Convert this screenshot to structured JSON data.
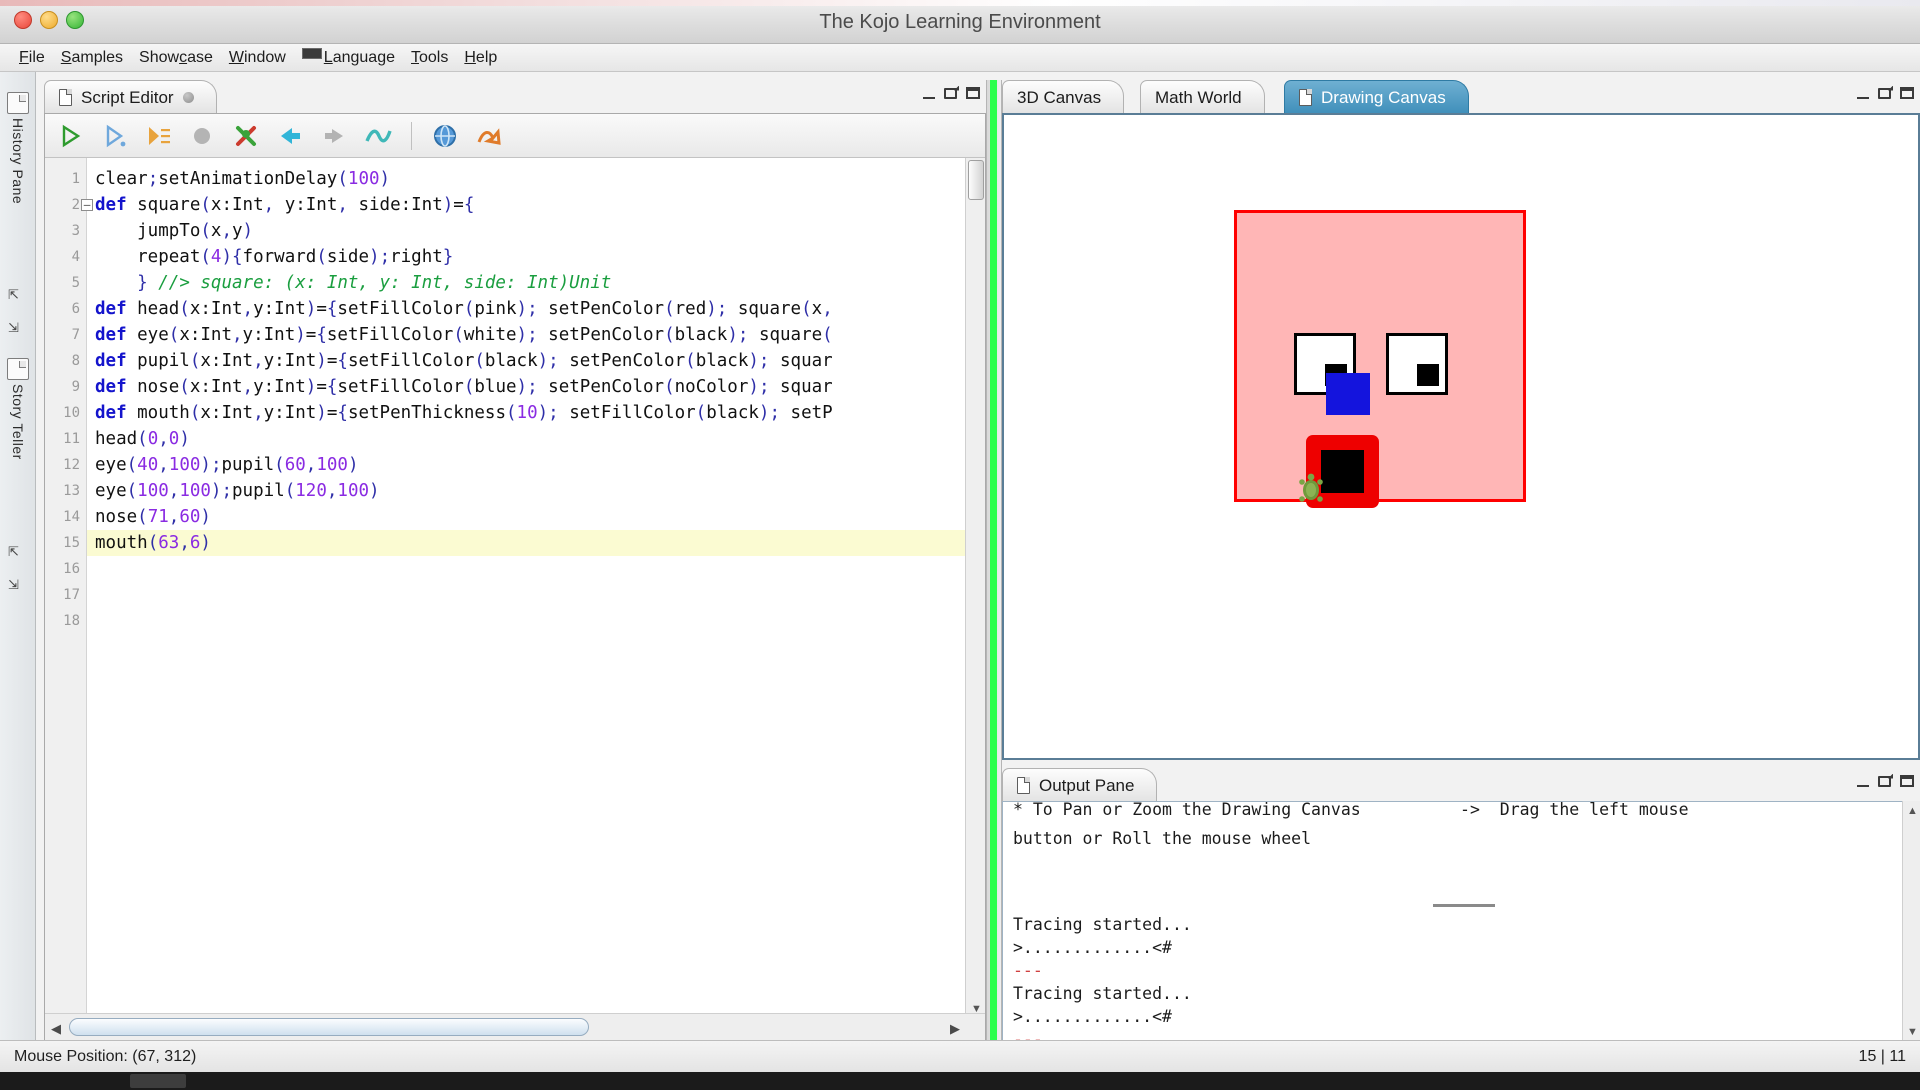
{
  "window": {
    "title": "The Kojo Learning Environment",
    "traffic_lights": [
      "close",
      "minimize",
      "zoom"
    ]
  },
  "menu": {
    "items": [
      {
        "label": "File",
        "mnemonic": "F"
      },
      {
        "label": "Samples",
        "mnemonic": "S"
      },
      {
        "label": "Showcase",
        "mnemonic": "S"
      },
      {
        "label": "Window",
        "mnemonic": "W"
      },
      {
        "label": "Language",
        "mnemonic": "L",
        "has_flag": true
      },
      {
        "label": "Tools",
        "mnemonic": "T"
      },
      {
        "label": "Help",
        "mnemonic": "H"
      }
    ]
  },
  "left_rail": {
    "items": [
      {
        "label": "History Pane",
        "icon": "pane-icon"
      },
      {
        "label": "Story Teller",
        "icon": "pane-icon"
      }
    ],
    "pin_glyph": "⇱",
    "float_glyph": "⇲"
  },
  "script_editor": {
    "tab_label": "Script Editor",
    "tab_icon": "document-icon",
    "modified_dot": "unsaved-indicator",
    "window_controls": {
      "minimize": "–",
      "float": "float",
      "maximize": "maximize"
    },
    "toolbar_buttons": [
      {
        "name": "run-script",
        "glyph": "▷",
        "color": "#2e9b2e"
      },
      {
        "name": "run-incrementally",
        "glyph": "▷",
        "color": "#5b9bd5"
      },
      {
        "name": "run-as-worksheet",
        "glyph": "▶",
        "color": "#e8a33d"
      },
      {
        "name": "stop-script",
        "glyph": "⬤",
        "color": "#a9a9a9"
      },
      {
        "name": "clear-output",
        "glyph": "✗",
        "color": "#3aa33a"
      },
      {
        "name": "undo",
        "glyph": "⬅",
        "color": "#31b5d8"
      },
      {
        "name": "redo",
        "glyph": "➡",
        "color": "#a9a9a9"
      },
      {
        "name": "format-code",
        "glyph": "∿",
        "color": "#3fb8b8"
      },
      {
        "name": "online-help",
        "glyph": "◍",
        "color": "#4a90d9"
      },
      {
        "name": "upload",
        "glyph": "↷",
        "color": "#e07b2a"
      }
    ],
    "lines": [
      {
        "n": 1,
        "fold": false,
        "highlight": false,
        "text": "clear;setAnimationDelay(100)"
      },
      {
        "n": 2,
        "fold": true,
        "highlight": false,
        "text": "def square(x:Int, y:Int, side:Int)={"
      },
      {
        "n": 3,
        "fold": false,
        "highlight": false,
        "text": "    jumpTo(x,y)"
      },
      {
        "n": 4,
        "fold": false,
        "highlight": false,
        "text": "    repeat(4){forward(side);right}"
      },
      {
        "n": 5,
        "fold": false,
        "highlight": false,
        "text": "    } //> square: (x: Int, y: Int, side: Int)Unit"
      },
      {
        "n": 6,
        "fold": false,
        "highlight": false,
        "text": "def head(x:Int,y:Int)={setFillColor(pink); setPenColor(red); square(x,"
      },
      {
        "n": 7,
        "fold": false,
        "highlight": false,
        "text": "def eye(x:Int,y:Int)={setFillColor(white); setPenColor(black); square("
      },
      {
        "n": 8,
        "fold": false,
        "highlight": false,
        "text": "def pupil(x:Int,y:Int)={setFillColor(black); setPenColor(black); squar"
      },
      {
        "n": 9,
        "fold": false,
        "highlight": false,
        "text": "def nose(x:Int,y:Int)={setFillColor(blue); setPenColor(noColor); squar"
      },
      {
        "n": 10,
        "fold": false,
        "highlight": false,
        "text": "def mouth(x:Int,y:Int)={setPenThickness(10); setFillColor(black); setP"
      },
      {
        "n": 11,
        "fold": false,
        "highlight": false,
        "text": "head(0,0)"
      },
      {
        "n": 12,
        "fold": false,
        "highlight": false,
        "text": "eye(40,100);pupil(60,100)"
      },
      {
        "n": 13,
        "fold": false,
        "highlight": false,
        "text": "eye(100,100);pupil(120,100)"
      },
      {
        "n": 14,
        "fold": false,
        "highlight": false,
        "text": "nose(71,60)"
      },
      {
        "n": 15,
        "fold": false,
        "highlight": true,
        "text": "mouth(63,6)"
      },
      {
        "n": 16,
        "fold": false,
        "highlight": false,
        "text": ""
      },
      {
        "n": 17,
        "fold": false,
        "highlight": false,
        "text": ""
      },
      {
        "n": 18,
        "fold": false,
        "highlight": false,
        "text": ""
      }
    ]
  },
  "canvas_panel": {
    "tabs": [
      {
        "label": "3D Canvas",
        "active": false,
        "icon": null
      },
      {
        "label": "Math World",
        "active": false,
        "icon": null
      },
      {
        "label": "Drawing Canvas",
        "active": true,
        "icon": "document-icon"
      }
    ],
    "window_controls": {
      "minimize": "–",
      "float": "float",
      "maximize": "maximize"
    },
    "drawing": {
      "description": "turtle-drawn face",
      "head_fill": "#ffb6b6",
      "head_pen": "#ff0000",
      "eye_fill": "#ffffff",
      "eye_pen": "#000000",
      "pupil_fill": "#000000",
      "nose_fill": "#1414dd",
      "mouth_pen": "#ee0000",
      "mouth_fill": "#000000"
    }
  },
  "output_pane": {
    "tab_label": "Output Pane",
    "tab_icon": "document-icon",
    "window_controls": {
      "minimize": "–",
      "float": "float",
      "maximize": "maximize"
    },
    "lines": [
      "* To Pan or Zoom the Drawing Canvas          ->  Drag the left mouse",
      "button or Roll the mouse wheel",
      "",
      "",
      "Tracing started...",
      ">.............<#",
      "---",
      "Tracing started...",
      ">.............<#",
      "---"
    ]
  },
  "status_bar": {
    "mouse_position_label": "Mouse Position: (67, 312)",
    "caret_position": "15 | 11"
  }
}
